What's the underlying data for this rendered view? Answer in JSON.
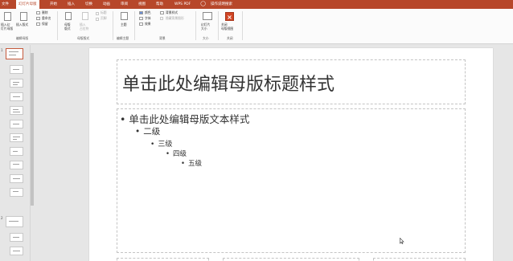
{
  "ribbon_tabs": [
    "文件",
    "幻灯片母版",
    "开始",
    "插入",
    "切换",
    "动画",
    "审阅",
    "视图",
    "帮助",
    "WPS PDF",
    "操作说明搜索"
  ],
  "ribbon": {
    "insert_slide_master": "插入幻\n灯片母版",
    "insert_layout": "插入版式",
    "delete": "删除",
    "rename": "重命名",
    "preserve": "保留",
    "master_layout": "母版\n版式",
    "insert_placeholder": "插入\n占位符",
    "title_check": "标题",
    "footer_check": "页脚",
    "theme": "主题",
    "colors": "颜色",
    "fonts": "字体",
    "effects": "效果",
    "background_styles": "背景样式",
    "hide_background": "隐藏背景图形",
    "slide_size": "幻灯片\n大小",
    "close_master": "关闭\n母版视图",
    "groups": {
      "edit_master": "编辑母版",
      "master_layout": "母版版式",
      "edit_theme": "编辑主题",
      "background": "背景",
      "size": "大小",
      "close": "关闭"
    }
  },
  "thumbnails": {
    "number_1": "1",
    "number_2": "2"
  },
  "slide": {
    "title": "单击此处编辑母版标题样式",
    "level1": "单击此处编辑母版文本样式",
    "level2": "二级",
    "level3": "三级",
    "level4": "四级",
    "level5": "五级"
  },
  "colors": {
    "accent": "#b7472a"
  }
}
